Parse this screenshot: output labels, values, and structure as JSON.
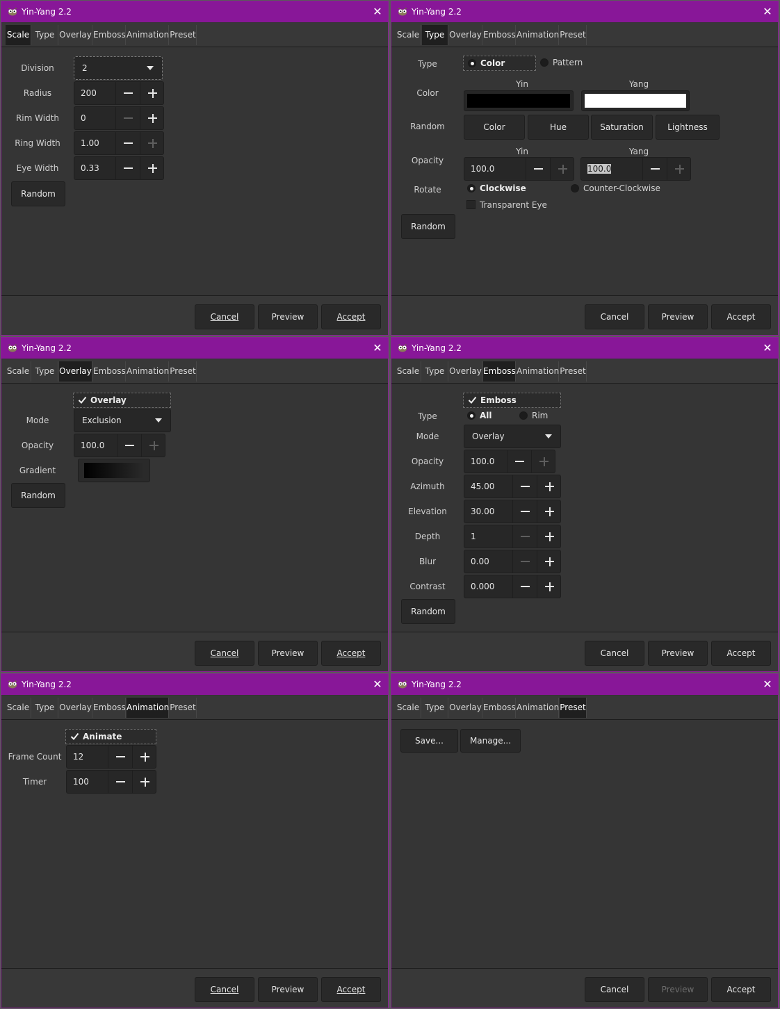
{
  "app": {
    "title": "Yin-Yang 2.2",
    "icon": "app-mascot-icon",
    "close_icon": "close-icon"
  },
  "tabs": [
    "Scale",
    "Type",
    "Overlay",
    "Emboss",
    "Animation",
    "Preset"
  ],
  "footer": {
    "cancel": "Cancel",
    "preview": "Preview",
    "accept": "Accept"
  },
  "scale": {
    "division_label": "Division",
    "division_value": "2",
    "radius_label": "Radius",
    "radius_value": "200",
    "rim_label": "Rim Width",
    "rim_value": "0",
    "ring_label": "Ring Width",
    "ring_value": "1.00",
    "eye_label": "Eye Width",
    "eye_value": "0.33",
    "random": "Random"
  },
  "type": {
    "type_label": "Type",
    "opt_color": "Color",
    "opt_pattern": "Pattern",
    "color_label": "Color",
    "yin": "Yin",
    "yang": "Yang",
    "yin_color": "#000000",
    "yang_color": "#ffffff",
    "random_label": "Random",
    "rand_color": "Color",
    "rand_hue": "Hue",
    "rand_saturation": "Saturation",
    "rand_lightness": "Lightness",
    "opacity_label": "Opacity",
    "yin_opacity": "100.0",
    "yang_opacity": "100.0",
    "rotate_label": "Rotate",
    "clockwise": "Clockwise",
    "counter": "Counter-Clockwise",
    "transparent_eye": "Transparent Eye",
    "random": "Random"
  },
  "overlay": {
    "check": "Overlay",
    "mode_label": "Mode",
    "mode_value": "Exclusion",
    "opacity_label": "Opacity",
    "opacity_value": "100.0",
    "gradient_label": "Gradient",
    "random": "Random"
  },
  "emboss": {
    "check": "Emboss",
    "type_label": "Type",
    "opt_all": "All",
    "opt_rim": "Rim",
    "mode_label": "Mode",
    "mode_value": "Overlay",
    "opacity_label": "Opacity",
    "opacity_value": "100.0",
    "azimuth_label": "Azimuth",
    "azimuth_value": "45.00",
    "elevation_label": "Elevation",
    "elevation_value": "30.00",
    "depth_label": "Depth",
    "depth_value": "1",
    "blur_label": "Blur",
    "blur_value": "0.00",
    "contrast_label": "Contrast",
    "contrast_value": "0.000",
    "random": "Random"
  },
  "animation": {
    "check": "Animate",
    "frame_label": "Frame Count",
    "frame_value": "12",
    "timer_label": "Timer",
    "timer_value": "100"
  },
  "preset": {
    "save": "Save...",
    "manage": "Manage..."
  }
}
